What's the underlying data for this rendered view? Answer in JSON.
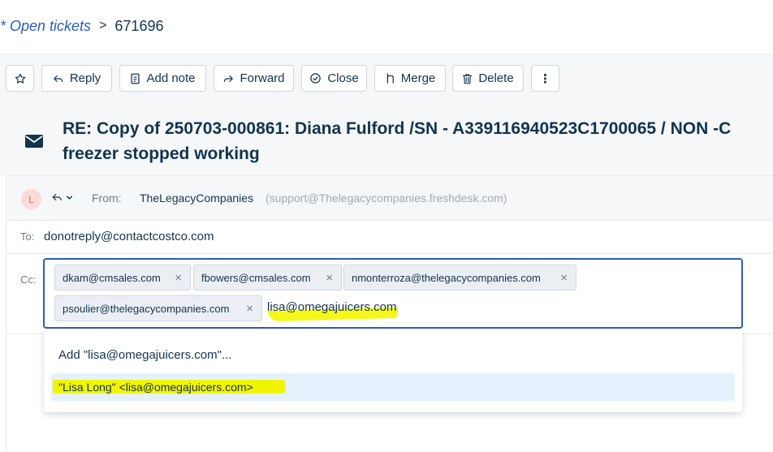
{
  "breadcrumb": {
    "parent": "* Open tickets",
    "separator": ">",
    "current": "671696"
  },
  "toolbar": {
    "reply": "Reply",
    "add_note": "Add note",
    "forward": "Forward",
    "close": "Close",
    "merge": "Merge",
    "delete": "Delete",
    "more": "⋮"
  },
  "ticket": {
    "subject_line1": "RE: Copy of 250703-000861: Diana Fulford /SN - A339116940523C1700065 / NON -C",
    "subject_line2": "freezer stopped working"
  },
  "message": {
    "avatar_initial": "L",
    "from_label": "From:",
    "from_name": "TheLegacyCompanies",
    "from_email": "(support@Thelegacycompanies.freshdesk.com)",
    "to_label": "To:",
    "to_value": "donotreply@contactcostco.com",
    "cc_label": "Cc:",
    "cc_chips": [
      "dkam@cmsales.com",
      "fbowers@cmsales.com",
      "nmonterroza@thelegacycompanies.com",
      "psoulier@thelegacycompanies.com"
    ],
    "cc_chip_remove": "×",
    "cc_typed": "lisa@omegajuicers.com"
  },
  "suggestions": {
    "add_option": "Add \"lisa@omegajuicers.com\"...",
    "contact_option": "\"Lisa Long\" <lisa@omegajuicers.com>"
  },
  "colors": {
    "accent": "#2c5cc5",
    "highlight": "#f4f600",
    "suggest_bg": "#e5f2fd"
  }
}
